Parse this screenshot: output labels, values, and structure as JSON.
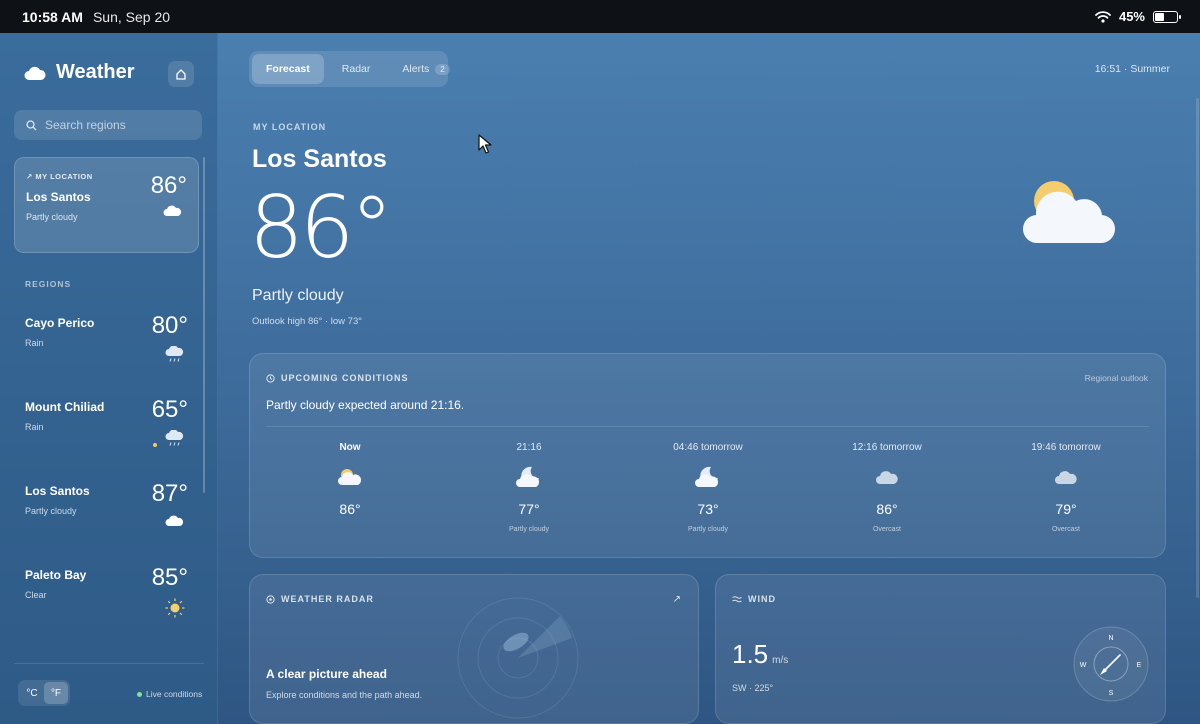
{
  "status_bar": {
    "time": "10:58 AM",
    "date": "Sun, Sep 20",
    "battery": "45%",
    "battery_level": 0.45
  },
  "sidebar": {
    "app_title": "Weather",
    "search_placeholder": "Search regions",
    "my_location": {
      "tag": "MY LOCATION",
      "name": "Los Santos",
      "condition": "Partly cloudy",
      "temp": "86°"
    },
    "regions_label": "REGIONS",
    "regions": [
      {
        "name": "Cayo Perico",
        "condition": "Rain",
        "temp": "80°",
        "icon": "rain-cloud-icon"
      },
      {
        "name": "Mount Chiliad",
        "condition": "Rain",
        "temp": "65°",
        "icon": "rain-cloud-icon"
      },
      {
        "name": "Los Santos",
        "condition": "Partly cloudy",
        "temp": "87°",
        "icon": "cloud-icon"
      },
      {
        "name": "Paleto Bay",
        "condition": "Clear",
        "temp": "85°",
        "icon": "sun-icon"
      }
    ],
    "units": {
      "celsius": "°C",
      "fahrenheit": "°F",
      "selected": "°F"
    },
    "live_label": "Live conditions"
  },
  "tabs": [
    {
      "label": "Forecast",
      "active": true
    },
    {
      "label": "Radar",
      "active": false
    },
    {
      "label": "Alerts",
      "badge": "2",
      "active": false
    }
  ],
  "clock": "16:51 · Summer",
  "main": {
    "location_label": "MY LOCATION",
    "city": "Los Santos",
    "temp": "86°",
    "condition": "Partly cloudy",
    "outlook": "Outlook high 86°  ·  low 73°"
  },
  "upcoming": {
    "title": "UPCOMING CONDITIONS",
    "link": "Regional outlook",
    "summary": "Partly cloudy expected around 21:16.",
    "hours": [
      {
        "time": "Now",
        "temp": "86°",
        "condition": "",
        "icon": "partly-cloudy-icon"
      },
      {
        "time": "21:16",
        "temp": "77°",
        "condition": "Partly cloudy",
        "icon": "night-partly-cloudy-icon"
      },
      {
        "time": "04:46 tomorrow",
        "temp": "73°",
        "condition": "Partly cloudy",
        "icon": "night-partly-cloudy-icon"
      },
      {
        "time": "12:16 tomorrow",
        "temp": "86°",
        "condition": "Overcast",
        "icon": "overcast-icon"
      },
      {
        "time": "19:46 tomorrow",
        "temp": "79°",
        "condition": "Overcast",
        "icon": "overcast-icon"
      }
    ]
  },
  "radar": {
    "title": "WEATHER RADAR",
    "heading": "A clear picture ahead",
    "subtitle": "Explore conditions and the path ahead."
  },
  "wind": {
    "title": "WIND",
    "speed": "1.5",
    "unit": "m/s",
    "direction": "SW · 225°",
    "compass": {
      "n": "N",
      "e": "E",
      "s": "S",
      "w": "W"
    }
  }
}
